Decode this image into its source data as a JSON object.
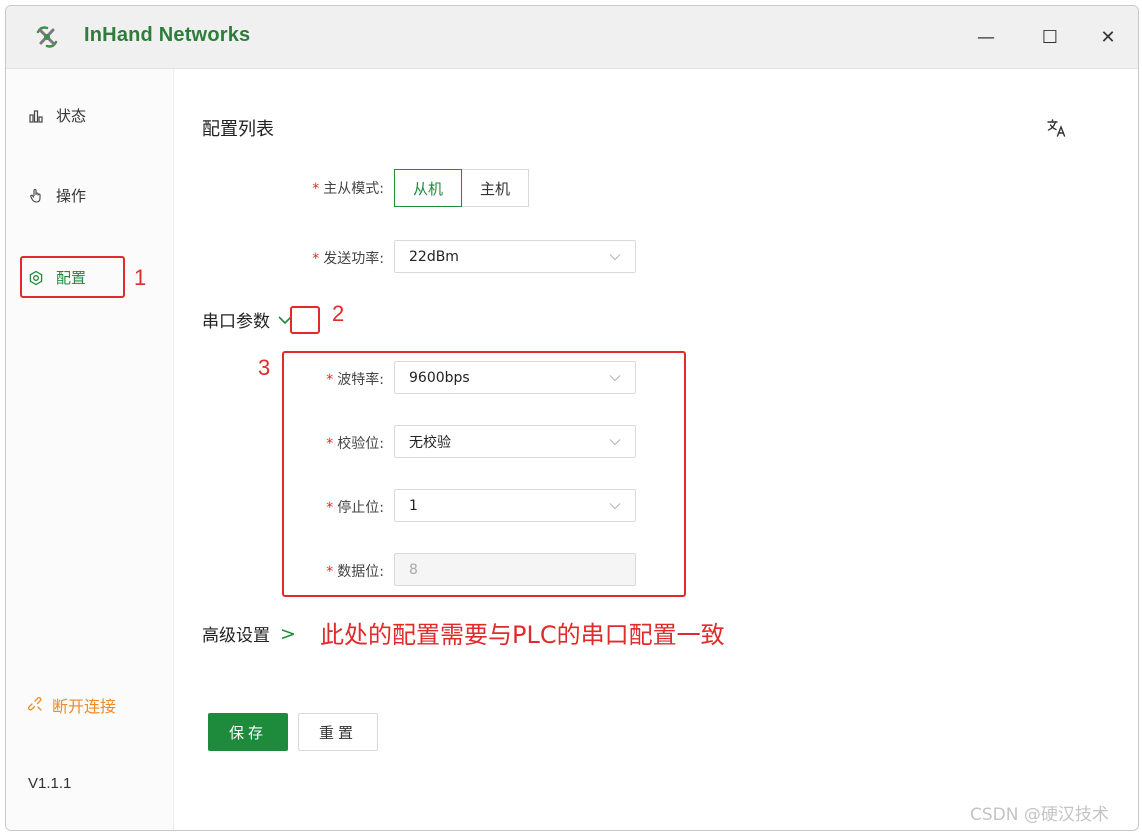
{
  "window": {
    "title": "InHand Networks",
    "minimize_symbol": "—",
    "maximize_symbol": "☐",
    "close_symbol": "✕"
  },
  "sidebar": {
    "items": [
      {
        "label": "状态",
        "icon": "bar-chart-icon"
      },
      {
        "label": "操作",
        "icon": "hand-pointer-icon"
      },
      {
        "label": "配置",
        "icon": "settings-icon",
        "active": true
      }
    ],
    "disconnect_label": "断开连接",
    "version": "V1.1.1"
  },
  "main": {
    "title": "配置列表",
    "mode": {
      "label": "主从模式:",
      "options": [
        "从机",
        "主机"
      ],
      "selected": "从机"
    },
    "tx_power": {
      "label": "发送功率:",
      "value": "22dBm"
    },
    "serial_section": {
      "title": "串口参数",
      "fields": [
        {
          "label": "波特率:",
          "value": "9600bps"
        },
        {
          "label": "校验位:",
          "value": "无校验"
        },
        {
          "label": "停止位:",
          "value": "1"
        },
        {
          "label": "数据位:",
          "value": "8",
          "disabled": true
        }
      ]
    },
    "advanced": {
      "title": "高级设置",
      "chevron": ">"
    },
    "save_label": "保存",
    "reset_label": "重置"
  },
  "annotations": {
    "num1": "1",
    "num2": "2",
    "num3": "3",
    "note": "此处的配置需要与PLC的串口配置一致"
  },
  "watermark": "CSDN @硬汉技术",
  "colors": {
    "accent": "#1e8a3c",
    "annotation_red": "#e02b2b",
    "disconnect_orange": "#f08a24"
  }
}
